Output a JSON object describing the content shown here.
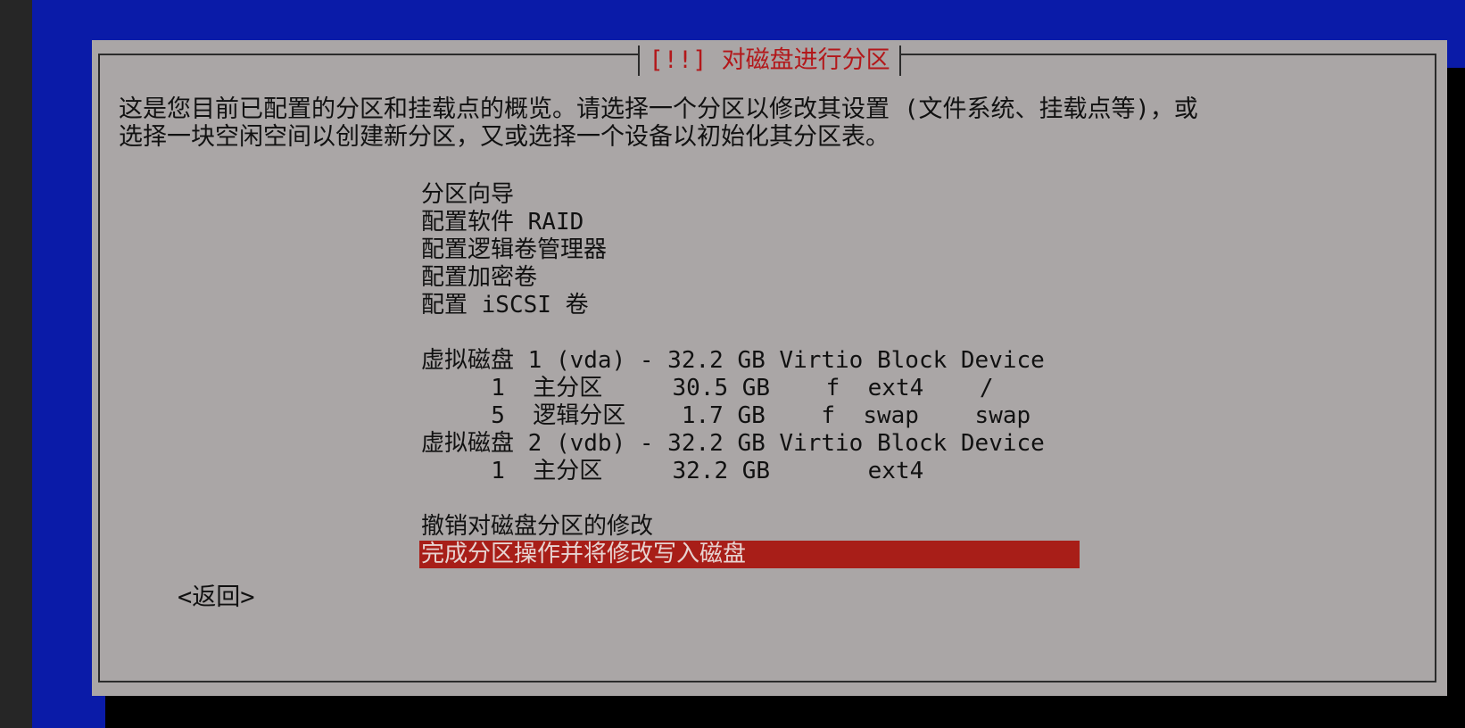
{
  "dialog": {
    "title": "[!!] 对磁盘进行分区",
    "description": [
      "这是您目前已配置的分区和挂载点的概览。请选择一个分区以修改其设置 (文件系统、挂载点等)，或",
      "选择一块空闲空间以创建新分区，又或选择一个设备以初始化其分区表。"
    ]
  },
  "menu": {
    "tools": [
      "分区向导",
      "配置软件 RAID",
      "配置逻辑卷管理器",
      "配置加密卷",
      "配置 iSCSI 卷"
    ],
    "disks": [
      "虚拟磁盘 1 (vda) - 32.2 GB Virtio Block Device",
      "     1  主分区     30.5 GB    f  ext4    /",
      "     5  逻辑分区    1.7 GB    f  swap    swap",
      "虚拟磁盘 2 (vdb) - 32.2 GB Virtio Block Device",
      "     1  主分区     32.2 GB       ext4"
    ],
    "undo": "撤销对磁盘分区的修改",
    "finish": "完成分区操作并将修改写入磁盘"
  },
  "buttons": {
    "back": "<返回>"
  },
  "colors": {
    "background": "#0a1ba8",
    "dialog": "#aaa6a6",
    "title_text": "#b3171a",
    "selection": "#a81e18"
  }
}
